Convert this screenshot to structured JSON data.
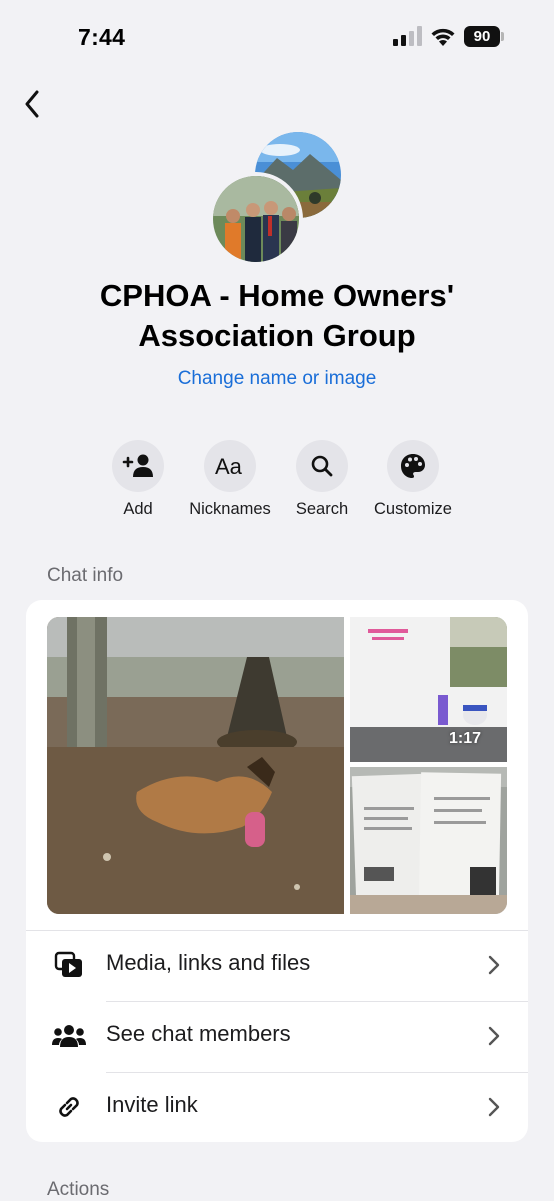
{
  "status_bar": {
    "time": "7:44",
    "battery": "90"
  },
  "header": {
    "back_icon": "chevron-left-icon"
  },
  "group": {
    "title": "CPHOA - Home Owners' Association Group",
    "change_link": "Change name or image"
  },
  "actions": [
    {
      "label": "Add",
      "icon": "add-person-icon"
    },
    {
      "label": "Nicknames",
      "icon": "text-aa-icon"
    },
    {
      "label": "Search",
      "icon": "search-icon"
    },
    {
      "label": "Customize",
      "icon": "palette-icon"
    }
  ],
  "chat_info": {
    "section_title": "Chat info",
    "media": {
      "video_duration": "1:17"
    },
    "rows": [
      {
        "label": "Media, links and files",
        "icon": "media-icon"
      },
      {
        "label": "See chat members",
        "icon": "members-icon"
      },
      {
        "label": "Invite link",
        "icon": "link-icon"
      }
    ]
  },
  "actions_section": {
    "title": "Actions"
  },
  "colors": {
    "accent": "#1a6ed8",
    "background": "#f2f2f5",
    "card": "#ffffff"
  }
}
